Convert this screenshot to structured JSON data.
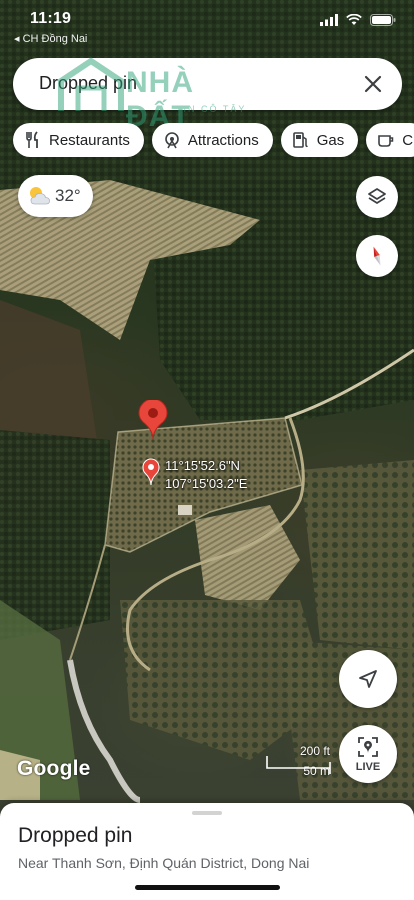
{
  "status_bar": {
    "time": "11:19",
    "back_app": "◂ CH Đồng Nai"
  },
  "search": {
    "value": "Dropped pin",
    "close_icon": "close-icon"
  },
  "watermark": {
    "big_text": "NHÀ ĐẤT",
    "small_text": "TIN CÔ TÂY"
  },
  "chips": [
    {
      "label": "Restaurants",
      "icon": "fork-knife-icon"
    },
    {
      "label": "Attractions",
      "icon": "attractions-icon"
    },
    {
      "label": "Gas",
      "icon": "gas-pump-icon"
    },
    {
      "label": "C",
      "icon": "coffee-icon"
    }
  ],
  "weather": {
    "temp": "32°",
    "icon": "partly-cloudy-icon"
  },
  "map": {
    "coords_lat": "11°15'52.6\"N",
    "coords_lng": "107°15'03.2\"E",
    "attribution": "Google",
    "scale_ft": "200 ft",
    "scale_m": "50 m"
  },
  "buttons": {
    "layers": "layers-icon",
    "compass": "compass-icon",
    "my_location": "navigation-arrow-icon",
    "live_label": "LIVE"
  },
  "sheet": {
    "title": "Dropped pin",
    "subtitle": "Near Thanh Sơn, Định Quán District, Dong Nai"
  },
  "colors": {
    "pin_red": "#e8463b",
    "compass_red": "#ea4335",
    "watermark_green": "#2ea27a"
  }
}
